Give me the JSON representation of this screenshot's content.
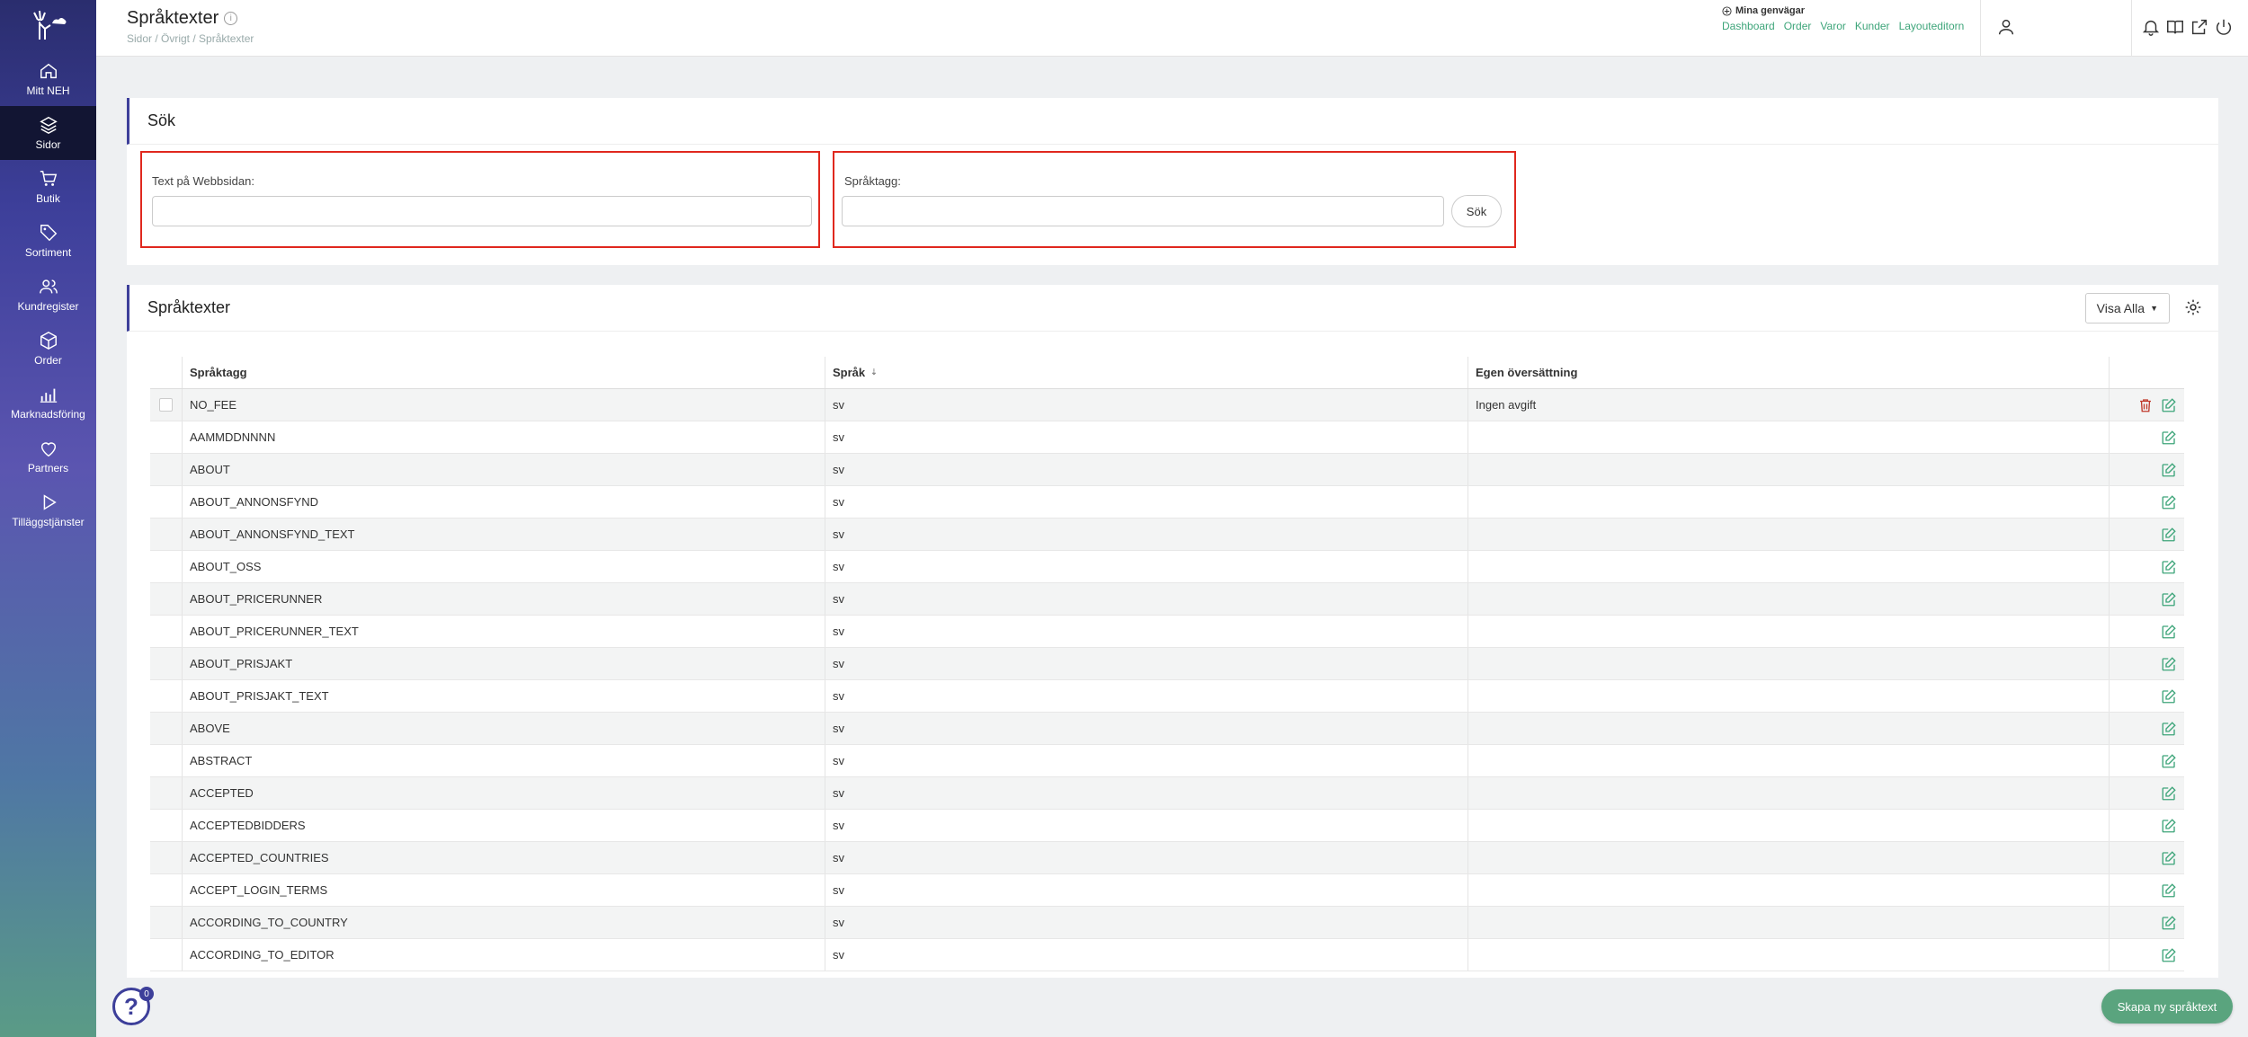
{
  "sidebar": {
    "items": [
      {
        "label": "Mitt NEH",
        "icon": "home-icon"
      },
      {
        "label": "Sidor",
        "icon": "layers-icon"
      },
      {
        "label": "Butik",
        "icon": "cart-icon"
      },
      {
        "label": "Sortiment",
        "icon": "tag-icon"
      },
      {
        "label": "Kundregister",
        "icon": "users-icon"
      },
      {
        "label": "Order",
        "icon": "box-icon"
      },
      {
        "label": "Marknadsföring",
        "icon": "bar-chart-icon"
      },
      {
        "label": "Partners",
        "icon": "heart-icon"
      },
      {
        "label": "Tilläggstjänster",
        "icon": "play-icon"
      }
    ],
    "active_index": 1
  },
  "header": {
    "title": "Språktexter",
    "breadcrumb": "Sidor / Övrigt / Språktexter",
    "shortcuts_title": "Mina genvägar",
    "shortcuts": [
      "Dashboard",
      "Order",
      "Varor",
      "Kunder",
      "Layouteditorn"
    ]
  },
  "search": {
    "title": "Sök",
    "text_label": "Text på Webbsidan:",
    "text_value": "",
    "tag_label": "Språktagg:",
    "tag_value": "",
    "button_label": "Sök"
  },
  "texts": {
    "title": "Språktexter",
    "show_all_label": "Visa Alla",
    "columns": [
      "Språktagg",
      "Språk",
      "Egen översättning"
    ],
    "rows": [
      {
        "tag": "NO_FEE",
        "lang": "sv",
        "own": "Ingen avgift"
      },
      {
        "tag": "AAMMDDNNNN",
        "lang": "sv",
        "own": ""
      },
      {
        "tag": "ABOUT",
        "lang": "sv",
        "own": ""
      },
      {
        "tag": "ABOUT_ANNONSFYND",
        "lang": "sv",
        "own": ""
      },
      {
        "tag": "ABOUT_ANNONSFYND_TEXT",
        "lang": "sv",
        "own": ""
      },
      {
        "tag": "ABOUT_OSS",
        "lang": "sv",
        "own": ""
      },
      {
        "tag": "ABOUT_PRICERUNNER",
        "lang": "sv",
        "own": ""
      },
      {
        "tag": "ABOUT_PRICERUNNER_TEXT",
        "lang": "sv",
        "own": ""
      },
      {
        "tag": "ABOUT_PRISJAKT",
        "lang": "sv",
        "own": ""
      },
      {
        "tag": "ABOUT_PRISJAKT_TEXT",
        "lang": "sv",
        "own": ""
      },
      {
        "tag": "ABOVE",
        "lang": "sv",
        "own": ""
      },
      {
        "tag": "ABSTRACT",
        "lang": "sv",
        "own": ""
      },
      {
        "tag": "ACCEPTED",
        "lang": "sv",
        "own": ""
      },
      {
        "tag": "ACCEPTEDBIDDERS",
        "lang": "sv",
        "own": ""
      },
      {
        "tag": "ACCEPTED_COUNTRIES",
        "lang": "sv",
        "own": ""
      },
      {
        "tag": "ACCEPT_LOGIN_TERMS",
        "lang": "sv",
        "own": ""
      },
      {
        "tag": "ACCORDING_TO_COUNTRY",
        "lang": "sv",
        "own": ""
      },
      {
        "tag": "ACCORDING_TO_EDITOR",
        "lang": "sv",
        "own": ""
      }
    ]
  },
  "help": {
    "badge": "0",
    "icon": "help-icon"
  },
  "create_button": "Skapa ny språktext",
  "colors": {
    "accent": "#3d3f9a",
    "link": "#3ea57a",
    "delete": "#c0392b",
    "highlight": "#e0281e"
  }
}
